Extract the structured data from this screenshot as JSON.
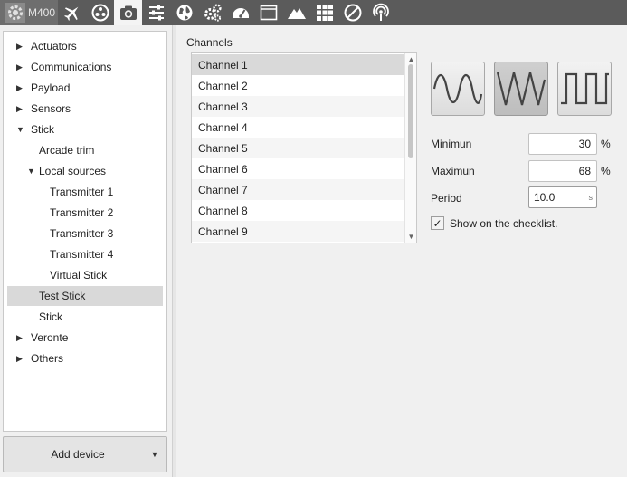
{
  "toolbar": {
    "app_name": "M400",
    "buttons": [
      {
        "icon": "plane-icon"
      },
      {
        "icon": "joystick-icon"
      },
      {
        "icon": "camera-icon",
        "active": true
      },
      {
        "icon": "sliders-icon"
      },
      {
        "icon": "globe-icon"
      },
      {
        "icon": "gears-icon"
      },
      {
        "icon": "gauge-icon"
      },
      {
        "icon": "window-icon"
      },
      {
        "icon": "mountain-icon"
      },
      {
        "icon": "grid-icon"
      },
      {
        "icon": "forbidden-icon"
      },
      {
        "icon": "signal-icon"
      }
    ]
  },
  "sidebar": {
    "items": [
      {
        "label": "Actuators",
        "arrow": "▶"
      },
      {
        "label": "Communications",
        "arrow": "▶"
      },
      {
        "label": "Payload",
        "arrow": "▶"
      },
      {
        "label": "Sensors",
        "arrow": "▶"
      },
      {
        "label": "Stick",
        "arrow": "▼"
      },
      {
        "label": "Arcade trim",
        "arrow": ""
      },
      {
        "label": "Local sources",
        "arrow": "▼"
      },
      {
        "label": "Transmitter 1",
        "arrow": ""
      },
      {
        "label": "Transmitter 2",
        "arrow": ""
      },
      {
        "label": "Transmitter 3",
        "arrow": ""
      },
      {
        "label": "Transmitter 4",
        "arrow": ""
      },
      {
        "label": "Virtual Stick",
        "arrow": ""
      },
      {
        "label": "Test Stick",
        "arrow": "",
        "selected": true
      },
      {
        "label": "Stick",
        "arrow": ""
      },
      {
        "label": "Veronte",
        "arrow": "▶"
      },
      {
        "label": "Others",
        "arrow": "▶"
      }
    ],
    "add_device_label": "Add device",
    "add_device_caret": "▼"
  },
  "channels": {
    "title": "Channels",
    "items": [
      "Channel 1",
      "Channel 2",
      "Channel 3",
      "Channel 4",
      "Channel 5",
      "Channel 6",
      "Channel 7",
      "Channel 8",
      "Channel 9"
    ],
    "selected_index": 0
  },
  "waveform": {
    "options": [
      "sine-wave-icon",
      "triangle-wave-icon",
      "square-wave-icon"
    ],
    "selected": "triangle-wave-icon"
  },
  "fields": {
    "minimum_label": "Minimun",
    "minimum_value": "30",
    "maximum_label": "Maximun",
    "maximum_value": "68",
    "percent_unit": "%",
    "period_label": "Period",
    "period_value": "10.0",
    "period_unit": "s"
  },
  "checklist": {
    "checked": true,
    "check_glyph": "✓",
    "label": "Show on the checklist."
  }
}
